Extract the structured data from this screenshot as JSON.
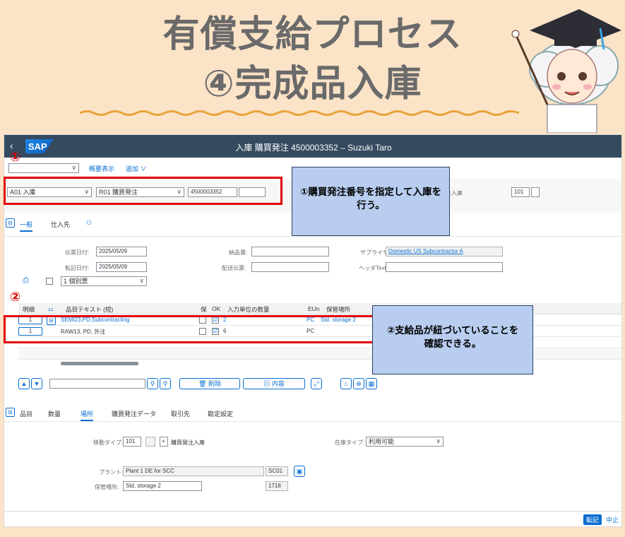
{
  "banner": {
    "line1": "有償支給プロセス",
    "line2": "④完成品入庫"
  },
  "shell": {
    "back": "‹",
    "logo": "SAP",
    "title": "入庫 購買発注 4500003352 – Suzuki Taro"
  },
  "toolbar": {
    "dropdown_value": "",
    "overview_link": "概要表示",
    "add_link": "追加 ∨"
  },
  "header": {
    "action": "A01 入庫",
    "reference": "R01 購買発注",
    "po_number": "4500003352",
    "po_extra": "",
    "movement_label": "注入庫",
    "movement_type": "101",
    "movement_extra": ""
  },
  "tabs_top": {
    "general": "一般",
    "vendor": "仕入先"
  },
  "general": {
    "doc_date_label": "伝票日付:",
    "doc_date": "2025/05/09",
    "post_date_label": "転記日付:",
    "post_date": "2025/05/09",
    "delivery_note_label": "納品書:",
    "delivery_note": "",
    "bill_lading_label": "配送伝票:",
    "bill_lading": "",
    "supplier_label": "サプライヤ:",
    "supplier": "Domestic US Subcontractor A",
    "header_text_label": "ヘッダText:",
    "header_text": "",
    "print_option": "1 個別票"
  },
  "grid": {
    "headers": [
      "明細",
      "品目テキスト (短)",
      "保",
      "OK",
      "入力単位の数量",
      "EUn",
      "保管場所"
    ],
    "rows": [
      {
        "item": "1",
        "text": "SEMI23,PD,Subcontracting",
        "ok": "☑",
        "qty": "2",
        "unit": "PC",
        "sloc": "Std. storage 2"
      },
      {
        "item": "1",
        "text": "RAW13, PD, 外注",
        "ok": "☑",
        "qty": "6",
        "unit": "PC",
        "sloc": ""
      }
    ]
  },
  "buttons": {
    "delete": "削除",
    "contents": "内容"
  },
  "tabs_bottom": [
    "品目",
    "数量",
    "場所",
    "購買発注データ",
    "取引先",
    "勘定設定"
  ],
  "detail": {
    "movement_type_label": "移動タイプ:",
    "movement_type": "101",
    "movement_desc": "購買発注入庫",
    "stock_type_label": "在庫タイプ:",
    "stock_type": "利用可能",
    "plant_label": "プラント:",
    "plant_name": "Plant 1 DE for SCC",
    "plant_code": "SC01",
    "sloc_label": "保管場所:",
    "sloc_name": "Std. storage 2",
    "sloc_code": "1718"
  },
  "footer": {
    "post": "転記",
    "cancel": "中止"
  },
  "annotations": {
    "marker1": "①",
    "marker2": "②",
    "callout1": "①購買発注番号を指定して入庫を行う。",
    "callout2": "②支給品が紐づいていることを確認できる。"
  }
}
